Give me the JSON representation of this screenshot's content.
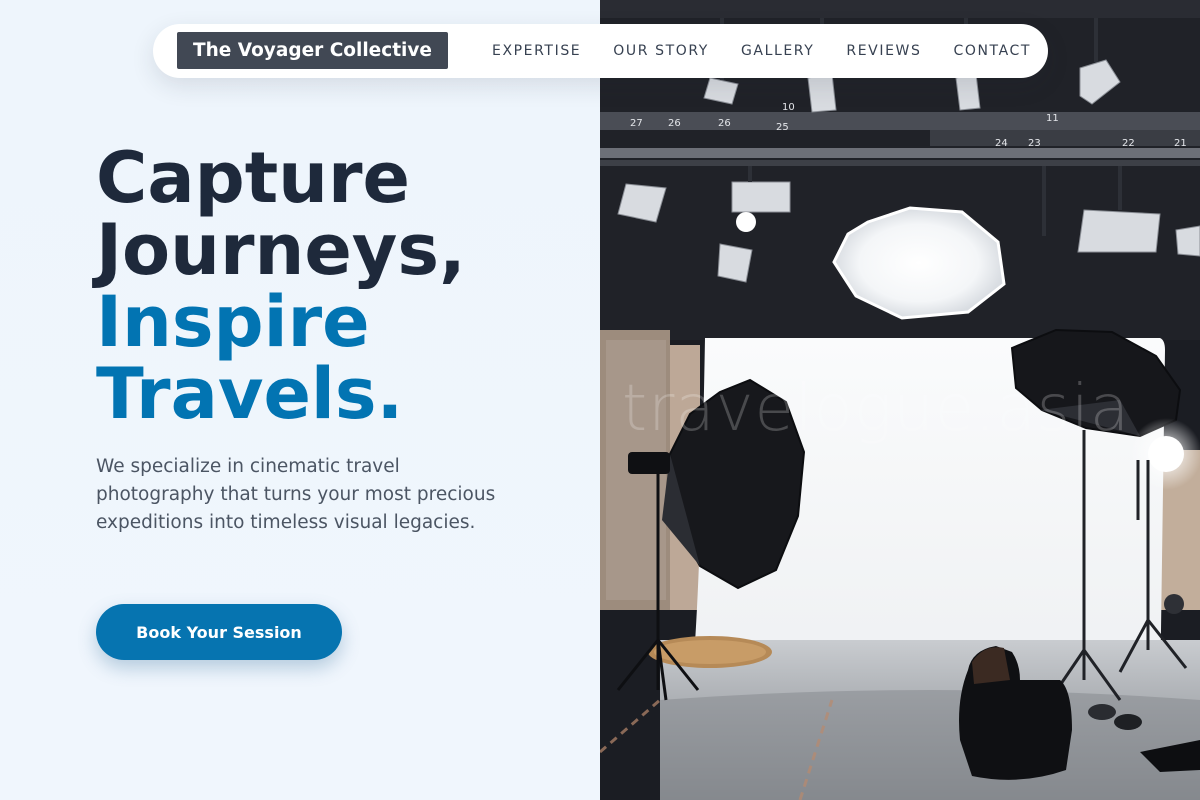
{
  "nav": {
    "brand": "The Voyager Collective",
    "links": [
      {
        "label": "EXPERTISE"
      },
      {
        "label": "OUR STORY"
      },
      {
        "label": "GALLERY"
      },
      {
        "label": "REVIEWS"
      },
      {
        "label": "CONTACT"
      }
    ]
  },
  "hero": {
    "headline_line1": "Capture",
    "headline_line2": "Journeys,",
    "headline_line3": "Inspire",
    "headline_line4": "Travels.",
    "description": "We specialize in cinematic travel photography that turns your most precious expeditions into timeless visual legacies.",
    "cta_label": "Book Your Session"
  },
  "photo": {
    "watermark": "travelogue.asia",
    "rig_numbers": [
      "27",
      "26",
      "26",
      "25",
      "10",
      "11",
      "24",
      "23",
      "22",
      "21"
    ]
  },
  "colors": {
    "background": "#eff6fd",
    "heading_dark": "#1e293b",
    "accent_blue": "#0274b2",
    "button": "#0674b0",
    "brand_box": "#414854"
  }
}
